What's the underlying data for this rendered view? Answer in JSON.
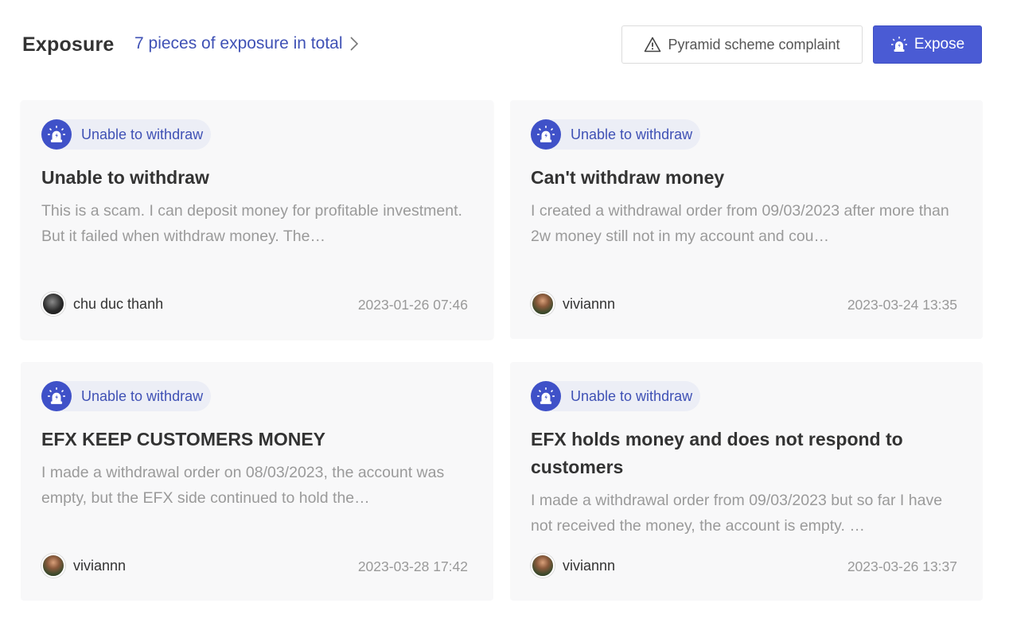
{
  "header": {
    "title": "Exposure",
    "total_link": "7 pieces of exposure in total",
    "complaint_label": "Pyramid scheme complaint",
    "expose_label": "Expose"
  },
  "colors": {
    "accent": "#4a5bd4",
    "tag_text": "#3f51b5",
    "card_bg": "#f8f8f9"
  },
  "cards": [
    {
      "tag": "Unable to withdraw",
      "title": "Unable to withdraw",
      "description": "This is a scam. I can deposit money for profitable investment. But it failed when withdraw money. The…",
      "author": "chu duc thanh",
      "date": "2023-01-26 07:46"
    },
    {
      "tag": "Unable to withdraw",
      "title": "Can't withdraw money",
      "description": "I created a withdrawal order from 09/03/2023 after more than 2w money still not in my account and cou…",
      "author": "viviannn",
      "date": "2023-03-24 13:35"
    },
    {
      "tag": "Unable to withdraw",
      "title": "EFX KEEP CUSTOMERS MONEY",
      "description": "I made a withdrawal order on 08/03/2023, the account was empty, but the EFX side continued to hold the…",
      "author": "viviannn",
      "date": "2023-03-28 17:42"
    },
    {
      "tag": "Unable to withdraw",
      "title": "EFX holds money and does not respond to customers",
      "description": "I made a withdrawal order from 09/03/2023 but so far I have not received the money, the account is empty. …",
      "author": "viviannn",
      "date": "2023-03-26 13:37"
    }
  ]
}
